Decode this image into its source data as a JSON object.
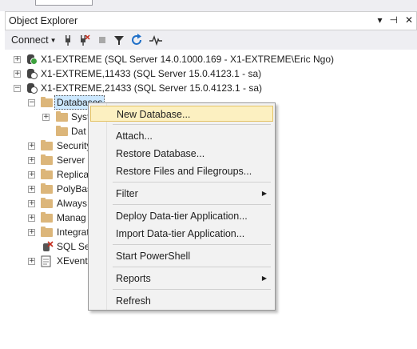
{
  "window": {
    "title": "Object Explorer",
    "controls": [
      "▾",
      "⊣",
      "✕"
    ]
  },
  "toolbar": {
    "connect_label": "Connect",
    "icons": [
      "connect-plug-icon",
      "disconnect-icon",
      "stop-icon",
      "filter-icon",
      "refresh-icon",
      "activity-monitor-icon"
    ]
  },
  "tree": {
    "servers": [
      {
        "label": "X1-EXTREME (SQL Server 14.0.1000.169 - X1-EXTREME\\Eric Ngo)",
        "expander": "+"
      },
      {
        "label": "X1-EXTREME,11433 (SQL Server 15.0.4123.1 - sa)",
        "expander": "+"
      },
      {
        "label": "X1-EXTREME,21433 (SQL Server 15.0.4123.1 - sa)",
        "expander": "−"
      }
    ],
    "databases": {
      "label": "Databases",
      "expander": "−"
    },
    "db_children": [
      {
        "label": "Syst",
        "expander": "+"
      },
      {
        "label": "Dat",
        "expander": ""
      }
    ],
    "server_children": [
      {
        "label": "Security",
        "expander": "+"
      },
      {
        "label": "Server O",
        "expander": "+"
      },
      {
        "label": "Replica",
        "expander": "+"
      },
      {
        "label": "PolyBas",
        "expander": "+"
      },
      {
        "label": "Always",
        "expander": "+"
      },
      {
        "label": "Manag",
        "expander": "+"
      },
      {
        "label": "Integrat",
        "expander": "+"
      },
      {
        "label": "SQL Ser",
        "expander": ""
      },
      {
        "label": "XEvent",
        "expander": "+"
      }
    ]
  },
  "context_menu": {
    "items": [
      {
        "label": "New Database...",
        "highlighted": true
      },
      {
        "label": "Attach..."
      },
      {
        "label": "Restore Database..."
      },
      {
        "label": "Restore Files and Filegroups..."
      },
      {
        "label": "Filter",
        "submenu": true
      },
      {
        "label": "Deploy Data-tier Application..."
      },
      {
        "label": "Import Data-tier Application..."
      },
      {
        "label": "Start PowerShell"
      },
      {
        "label": "Reports",
        "submenu": true
      },
      {
        "label": "Refresh"
      }
    ]
  },
  "colors": {
    "selection": "#cce8ff",
    "menu_highlight": "#fcf0c1",
    "folder": "#dcb67a",
    "accent": "#1e6fc8"
  }
}
